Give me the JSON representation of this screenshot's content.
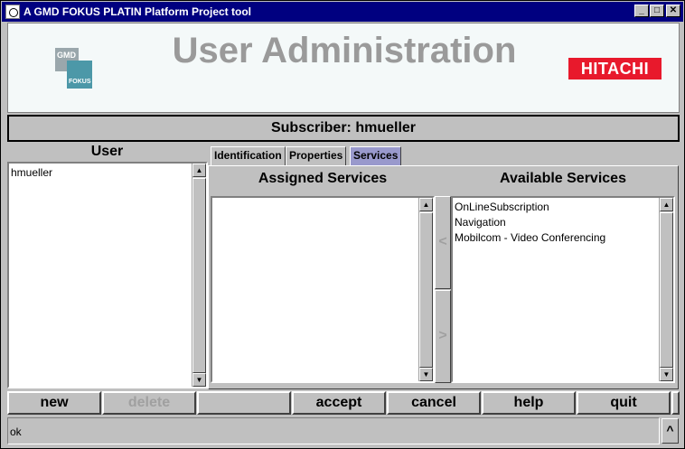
{
  "window": {
    "title": "A GMD FOKUS PLATIN Platform Project tool",
    "minimize_glyph": "_",
    "maximize_glyph": "□",
    "close_glyph": "✕"
  },
  "header": {
    "app_title": "User Administration",
    "left_logo": {
      "line1": "GMD",
      "line2": "FOKUS"
    },
    "right_logo": "HITACHI",
    "colors": {
      "title": "#9a9a9a",
      "brand_red": "#e8192c",
      "logo_teal": "#4c98a8"
    }
  },
  "subscriber": {
    "label": "Subscriber: hmueller"
  },
  "user_panel": {
    "heading": "User",
    "users": [
      "hmueller"
    ]
  },
  "tabs": [
    {
      "label": "Identification",
      "active": false
    },
    {
      "label": "Properties",
      "active": false
    },
    {
      "label": "Services",
      "active": true
    }
  ],
  "services": {
    "assigned_heading": "Assigned Services",
    "available_heading": "Available Services",
    "assigned": [],
    "available": [
      "OnLineSubscription",
      "Navigation",
      "Mobilcom - Video Conferencing"
    ],
    "move_left_glyph": "<",
    "move_right_glyph": ">"
  },
  "buttons": {
    "new": "new",
    "delete": "delete",
    "blank": "",
    "accept": "accept",
    "cancel": "cancel",
    "help": "help",
    "quit": "quit"
  },
  "status": {
    "text": "ok",
    "toggle_glyph": "^"
  },
  "scroll_glyphs": {
    "up": "▲",
    "down": "▼"
  }
}
